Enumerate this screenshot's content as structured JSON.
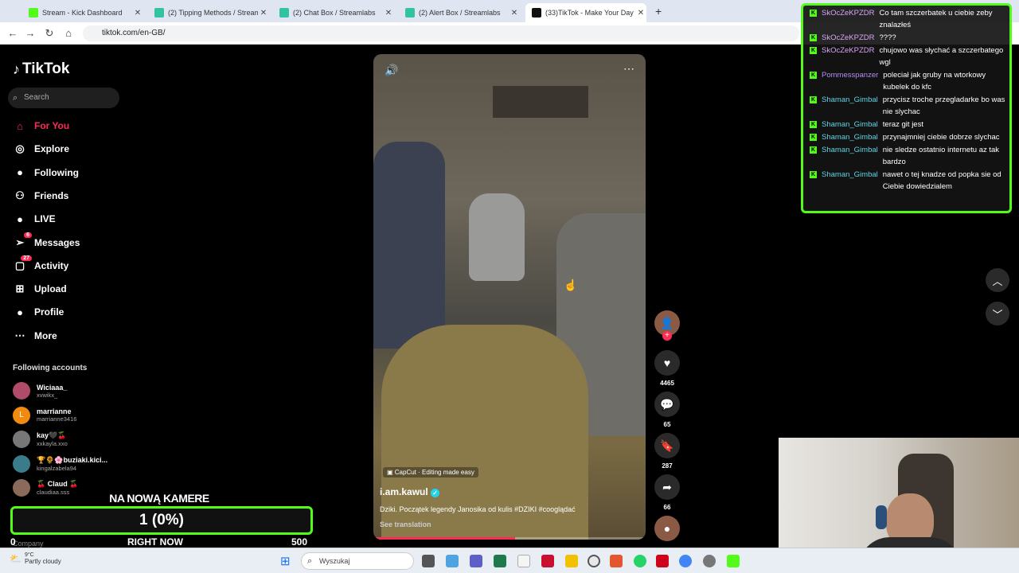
{
  "browser": {
    "tabs": [
      {
        "title": "Stream - Kick Dashboard",
        "color": "#53fc18"
      },
      {
        "title": "(2) Tipping Methods / Streamla",
        "color": "#31c3a2"
      },
      {
        "title": "(2) Chat Box / Streamlabs",
        "color": "#31c3a2"
      },
      {
        "title": "(2) Alert Box / Streamlabs",
        "color": "#31c3a2"
      },
      {
        "title": "(33)TikTok - Make Your Day",
        "color": "#111111"
      }
    ],
    "new_tab": "+",
    "url": "tiktok.com/en-GB/"
  },
  "tiktok": {
    "logo": "TikTok",
    "search_placeholder": "Search",
    "nav": [
      {
        "label": "For You",
        "icon": "home-icon",
        "active": true
      },
      {
        "label": "Explore",
        "icon": "compass-icon"
      },
      {
        "label": "Following",
        "icon": "following-avatar-icon"
      },
      {
        "label": "Friends",
        "icon": "friends-icon"
      },
      {
        "label": "LIVE",
        "icon": "live-icon"
      },
      {
        "label": "Messages",
        "icon": "messages-icon",
        "badge": "6"
      },
      {
        "label": "Activity",
        "icon": "activity-icon",
        "badge": "27"
      },
      {
        "label": "Upload",
        "icon": "upload-icon"
      },
      {
        "label": "Profile",
        "icon": "profile-icon"
      },
      {
        "label": "More",
        "icon": "more-icon"
      }
    ],
    "following_title": "Following accounts",
    "accounts": [
      {
        "name": "Wiciaaa_",
        "handle": "xvwikx_",
        "color": "#b04b6a"
      },
      {
        "name": "marrianne",
        "handle": "marrianne3416",
        "color": "#f08a10",
        "initial": "L"
      },
      {
        "name": "kay🖤🍒",
        "handle": "xxkayla.xxo",
        "color": "#777"
      },
      {
        "name": "🏆🌻🌸buziaki.kici...",
        "handle": "kingalzabela94",
        "color": "#3a7d8a"
      },
      {
        "name": "🍒 Claud 🍒",
        "handle": "claudiaa.sss",
        "color": "#8a6a5a"
      }
    ],
    "footer_partial": "Company",
    "video": {
      "capcut": "CapCut · Editing made easy",
      "author": "i.am.kawul",
      "verified": true,
      "description": "Dziki. Początek legendy Janosika od kulis #DZIKI #cooglądać",
      "see_translation": "See translation",
      "progress_fraction": 0.52
    },
    "actions": {
      "likes": "4465",
      "comments": "65",
      "saves": "287",
      "shares": "66"
    }
  },
  "chat": {
    "messages": [
      {
        "user": "SkOcZeKPZDR",
        "user_color": "#d8a6f5",
        "text": "Co tam szczerbatek u ciebie zeby znalazłeś"
      },
      {
        "user": "SkOcZeKPZDR",
        "user_color": "#d8a6f5",
        "text": "????"
      },
      {
        "user": "SkOcZeKPZDR",
        "user_color": "#d8a6f5",
        "text": "chujowo was słychać a szczerbatego wgl"
      },
      {
        "user": "Pommesspanzer",
        "user_color": "#b58bf5",
        "text": "poleciał jak gruby na wtorkowy kubelek do kfc"
      },
      {
        "user": "Shaman_Gimbal",
        "user_color": "#5ed6e6",
        "text": "przycisz troche przegladarke bo was nie slychac"
      },
      {
        "user": "Shaman_Gimbal",
        "user_color": "#5ed6e6",
        "text": "teraz git jest"
      },
      {
        "user": "Shaman_Gimbal",
        "user_color": "#5ed6e6",
        "text": "przynajmniej ciebie dobrze slychac"
      },
      {
        "user": "Shaman_Gimbal",
        "user_color": "#5ed6e6",
        "text": "nie sledze ostatnio internetu az tak bardzo"
      },
      {
        "user": "Shaman_Gimbal",
        "user_color": "#5ed6e6",
        "text": "nawet o tej knadze od popka sie od Ciebie dowiedzialem"
      }
    ]
  },
  "goal": {
    "title": "NA NOWĄ KAMERE",
    "display": "1 (0%)",
    "min": "0",
    "now_label": "RIGHT NOW",
    "max": "500"
  },
  "taskbar": {
    "temp": "9°C",
    "condition": "Partly cloudy",
    "search_placeholder": "Wyszukaj"
  }
}
